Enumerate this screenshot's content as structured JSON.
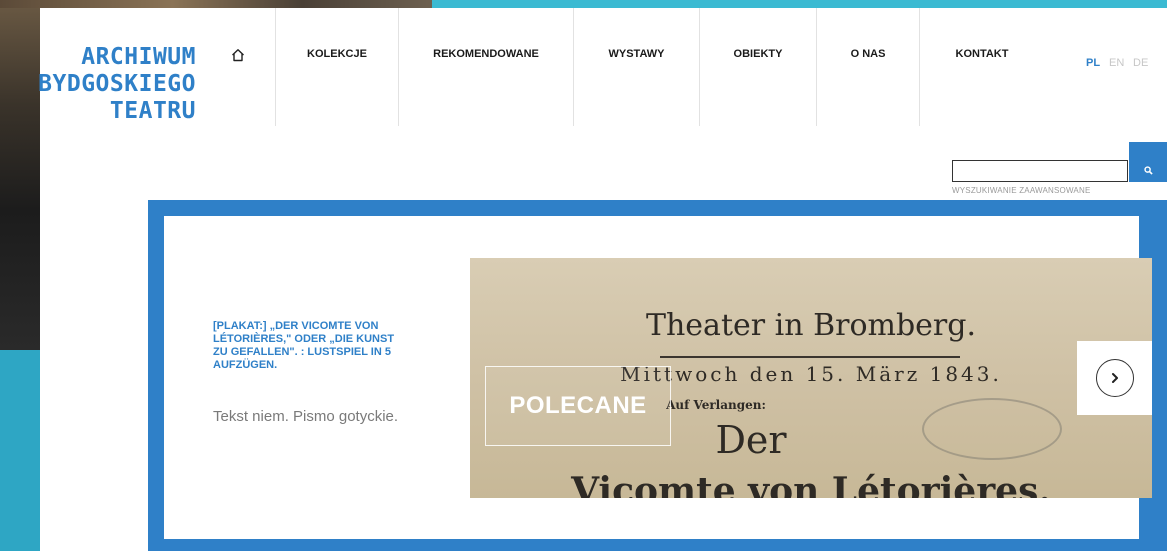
{
  "logo": {
    "line1": "ARCHIWUM",
    "line2": "BYDGOSKIEGO",
    "line3": "TEATRU"
  },
  "nav": {
    "home_icon": "home-icon",
    "items": [
      {
        "label": "KOLEKCJE"
      },
      {
        "label": "REKOMENDOWANE"
      },
      {
        "label": "WYSTAWY"
      },
      {
        "label": "OBIEKTY"
      },
      {
        "label": "O NAS"
      },
      {
        "label": "KONTAKT"
      }
    ]
  },
  "languages": {
    "active": "PL",
    "others": [
      "EN",
      "DE"
    ]
  },
  "search": {
    "value": "",
    "placeholder": "",
    "button_icon": "search-icon",
    "advanced_label": "WYSZUKIWANIE ZAAWANSOWANE"
  },
  "featured": {
    "title": "[PLAKAT:] „DER VICOMTE VON LÉTORIÈRES,\" ODER „DIE KUNST ZU GEFALLEN\". : LUSTSPIEL IN 5 AUFZÜGEN.",
    "description": "Tekst niem. Pismo gotyckie.",
    "badge": "POLECANE",
    "poster_lines": {
      "l1": "Theater in Bromberg.",
      "l2": "Mittwoch den 15. März 1843.",
      "l3": "Auf Verlangen:",
      "l4": "Der",
      "l5": "Vicomte von Létorières."
    },
    "next_icon": "chevron-right-icon"
  },
  "colors": {
    "brand_blue": "#2f80c8",
    "teal": "#3bbad2",
    "lang_inactive": "#c7c7c7"
  }
}
